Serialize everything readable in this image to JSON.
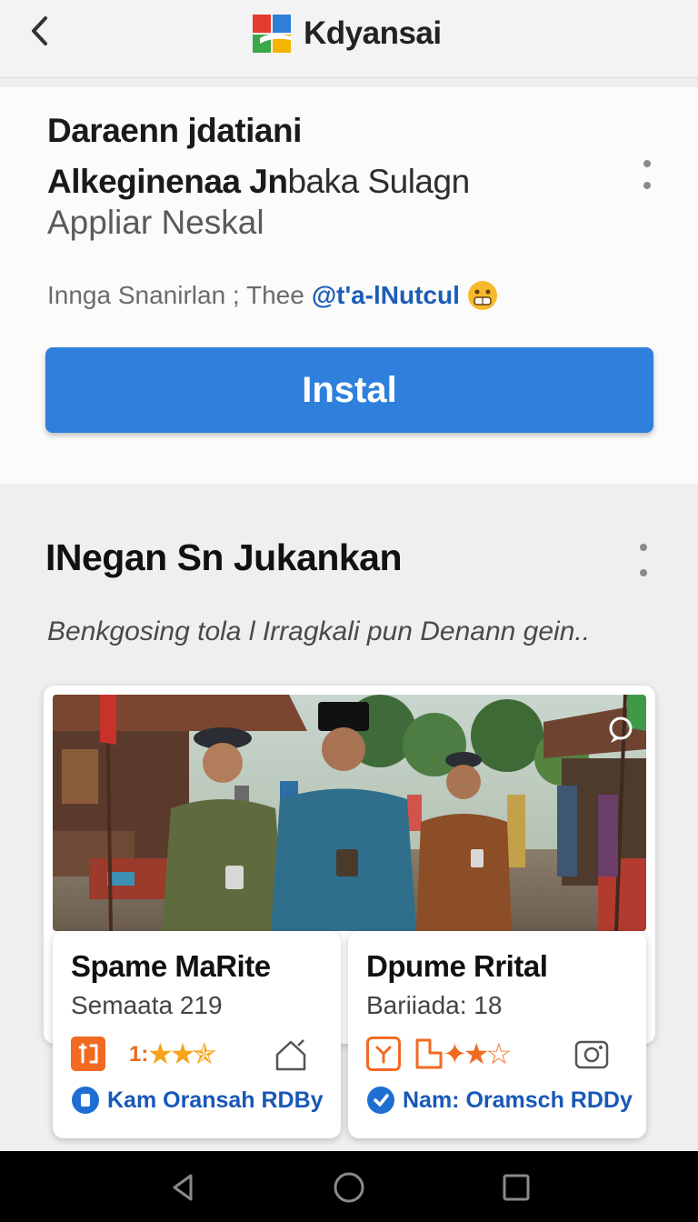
{
  "topbar": {
    "brand_name": "Kdyansai"
  },
  "app": {
    "title_line1": "Daraenn jdatiani",
    "title_line2_bold": "Alkeginenaa Jn",
    "title_line2_regular": "baka Sulagn",
    "subtitle": "Appliar Neskal",
    "meta_text": "Innga Snanirlan ; Thee",
    "meta_handle": "@t'a-lNutcul",
    "install_label": "Instal"
  },
  "section": {
    "title": "INegan Sn Jukankan",
    "description": "Benkgosing tola l Irragkali pun Denann gein.."
  },
  "items": [
    {
      "name": "Spame MaRite",
      "subtitle": "Semaata 219",
      "rating_prefix": "1:",
      "stars": 2.5,
      "developer": "Kam Oransah RDBy"
    },
    {
      "name": "Dpume Rrital",
      "subtitle": "Bariiada: 18",
      "rating_prefix": "",
      "stars": 2.5,
      "developer": "Nam: Oramsch RDDy"
    }
  ],
  "colors": {
    "accent": "#2e80dc",
    "link": "#1858b8",
    "star": "#f5a31a",
    "category_orange": "#f26a22"
  },
  "icons": [
    "back-arrow-icon",
    "brand-logo-icon",
    "more-vert-icon",
    "emoji-icon",
    "pin-icon",
    "category-icon",
    "star-icon",
    "home-icon",
    "shield-check-icon",
    "camera-icon",
    "nav-back-icon",
    "nav-home-icon",
    "nav-recents-icon"
  ]
}
